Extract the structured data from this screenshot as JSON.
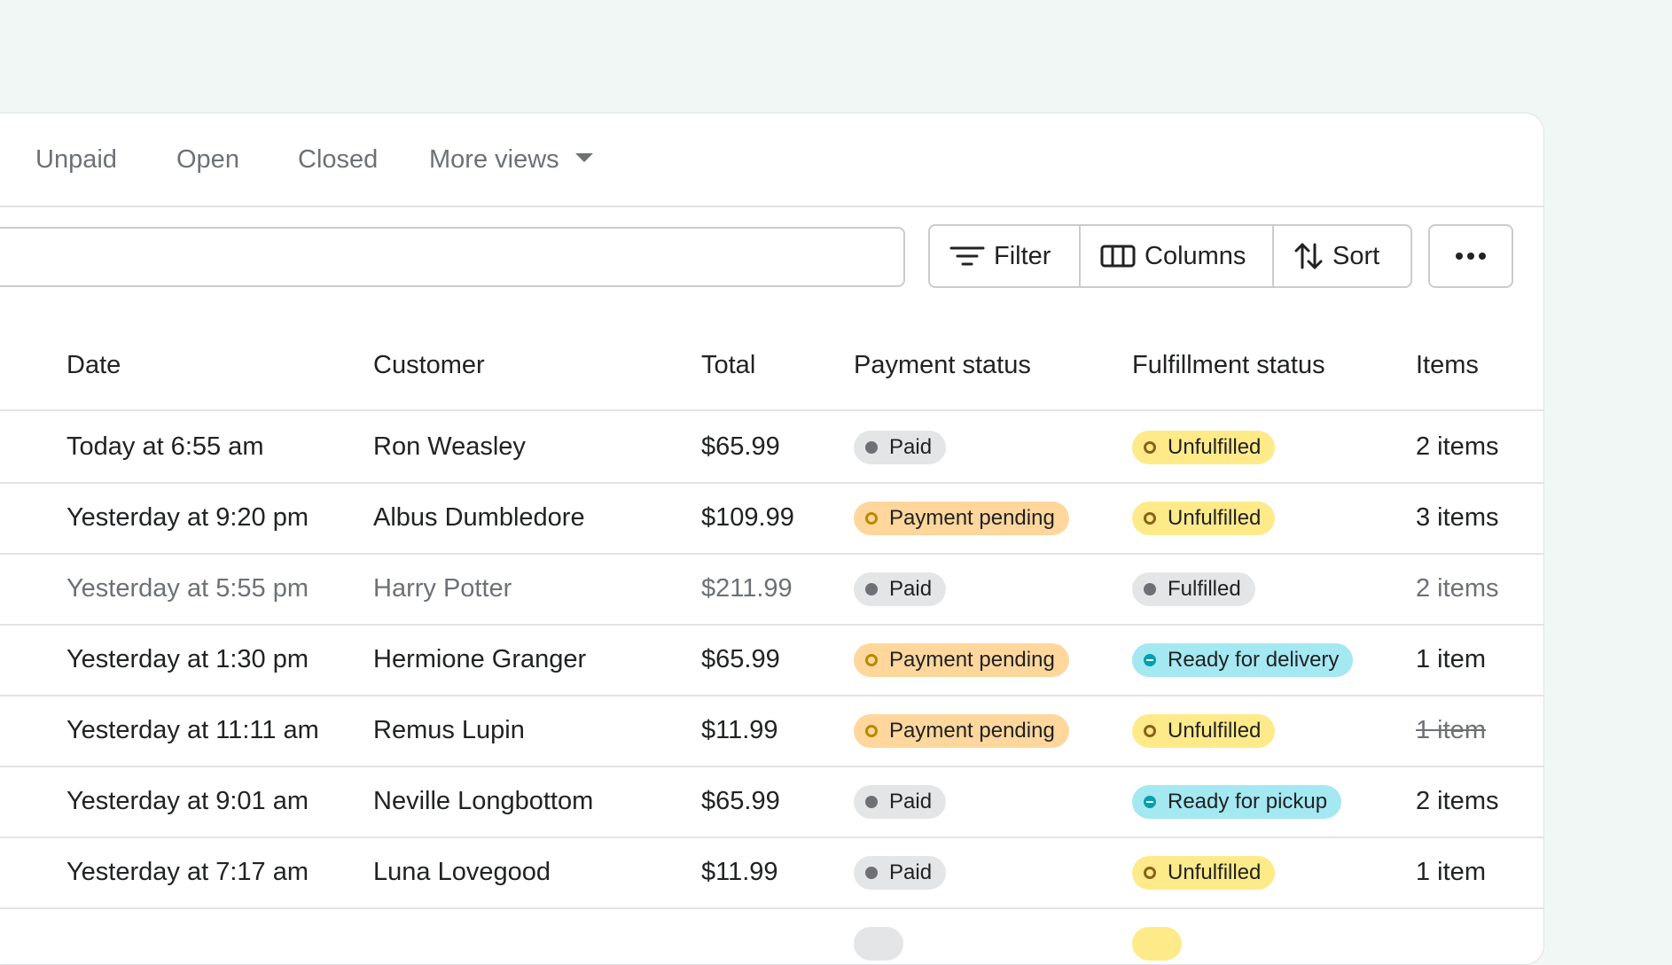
{
  "tabs": [
    {
      "label": "Unpaid"
    },
    {
      "label": "Open"
    },
    {
      "label": "Closed"
    },
    {
      "label": "More views"
    }
  ],
  "toolbar": {
    "search_value": "",
    "filter_label": "Filter",
    "columns_label": "Columns",
    "sort_label": "Sort",
    "more_label": "•••"
  },
  "table": {
    "headers": {
      "date": "Date",
      "customer": "Customer",
      "total": "Total",
      "payment": "Payment status",
      "fulfillment": "Fulfillment status",
      "items": "Items"
    },
    "rows": [
      {
        "date": "Today at 6:55 am",
        "customer": "Ron Weasley",
        "total": "$65.99",
        "payment": "Paid",
        "fulfillment": "Unfulfilled",
        "items": "2 items"
      },
      {
        "date": "Yesterday at 9:20 pm",
        "customer": "Albus Dumbledore",
        "total": "$109.99",
        "payment": "Payment pending",
        "fulfillment": "Unfulfilled",
        "items": "3 items"
      },
      {
        "date": "Yesterday at 5:55 pm",
        "customer": "Harry Potter",
        "total": "$211.99",
        "payment": "Paid",
        "fulfillment": "Fulfilled",
        "items": "2 items"
      },
      {
        "date": "Yesterday at 1:30 pm",
        "customer": "Hermione Granger",
        "total": "$65.99",
        "payment": "Payment pending",
        "fulfillment": "Ready for delivery",
        "items": "1 item"
      },
      {
        "date": "Yesterday at 11:11 am",
        "customer": "Remus Lupin",
        "total": "$11.99",
        "payment": "Payment pending",
        "fulfillment": "Unfulfilled",
        "items": "1 item"
      },
      {
        "date": "Yesterday at 9:01 am",
        "customer": "Neville Longbottom",
        "total": "$65.99",
        "payment": "Paid",
        "fulfillment": "Ready for pickup",
        "items": "2 items"
      },
      {
        "date": "Yesterday at 7:17 am",
        "customer": "Luna Lovegood",
        "total": "$11.99",
        "payment": "Paid",
        "fulfillment": "Unfulfilled",
        "items": "1 item"
      }
    ]
  },
  "icons": {
    "filter": "filter-icon",
    "columns": "columns-icon",
    "sort": "sort-icon",
    "more": "more-horizontal-icon",
    "caret": "caret-down-icon"
  },
  "colors": {
    "background": "#f1f7f4",
    "paid_badge": "#e4e5e7",
    "pending_badge": "#ffd79d",
    "unfulfilled_badge": "#ffea8a",
    "ready_badge": "#a4e8f2"
  }
}
